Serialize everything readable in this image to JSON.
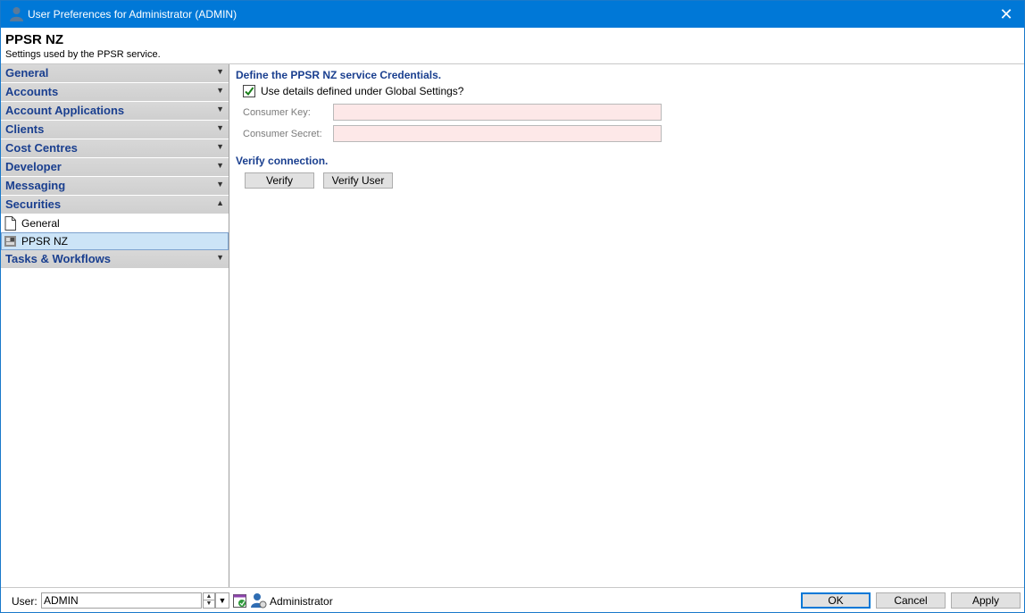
{
  "window": {
    "title": "User Preferences for Administrator (ADMIN)",
    "close_glyph": "✕"
  },
  "header": {
    "title": "PPSR NZ",
    "subtitle": "Settings used by the PPSR service."
  },
  "sidebar": {
    "categories": [
      {
        "label": "General",
        "expanded": false
      },
      {
        "label": "Accounts",
        "expanded": false
      },
      {
        "label": "Account Applications",
        "expanded": false
      },
      {
        "label": "Clients",
        "expanded": false
      },
      {
        "label": "Cost Centres",
        "expanded": false
      },
      {
        "label": "Developer",
        "expanded": false
      },
      {
        "label": "Messaging",
        "expanded": false
      },
      {
        "label": "Securities",
        "expanded": true
      },
      {
        "label": "Tasks & Workflows",
        "expanded": false
      }
    ],
    "securities_items": [
      {
        "label": "General",
        "icon": "document-icon",
        "selected": false
      },
      {
        "label": "PPSR NZ",
        "icon": "ppsr-icon",
        "selected": true
      }
    ],
    "chevron_down": "▼",
    "chevron_up": "▲"
  },
  "main": {
    "credentials_heading": "Define the PPSR NZ service Credentials.",
    "use_global_label": "Use details defined under Global Settings?",
    "use_global_checked": true,
    "consumer_key_label": "Consumer Key:",
    "consumer_key_value": "",
    "consumer_secret_label": "Consumer Secret:",
    "consumer_secret_value": "",
    "field_color": "#fde8e8",
    "verify_heading": "Verify connection.",
    "verify_button": "Verify",
    "verify_user_button": "Verify User"
  },
  "footer": {
    "user_label": "User:",
    "user_value": "ADMIN",
    "user_name": "Administrator",
    "ok_button": "OK",
    "cancel_button": "Cancel",
    "apply_button": "Apply"
  },
  "colors": {
    "titlebar": "#0078d7",
    "heading_blue": "#1a3f8f",
    "selection": "#cce4f7"
  }
}
